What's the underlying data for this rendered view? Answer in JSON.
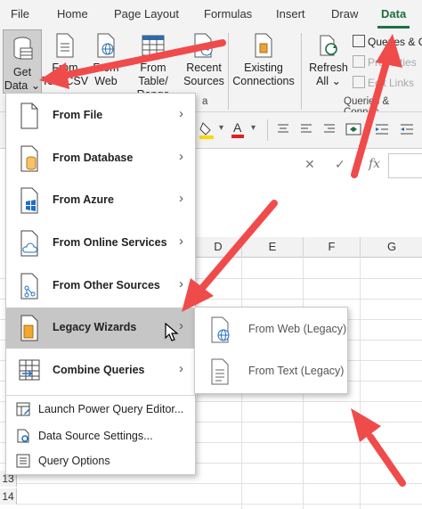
{
  "ribbon_tabs": [
    "File",
    "Home",
    "Page Layout",
    "Formulas",
    "Insert",
    "Draw",
    "Data"
  ],
  "ribbon": {
    "get_data": [
      "Get",
      "Data ⌄"
    ],
    "from_text_csv": [
      "From",
      "Text/CSV"
    ],
    "from_web": [
      "From",
      "Web"
    ],
    "from_table_range": [
      "From Table/",
      "Range"
    ],
    "recent_sources": [
      "Recent",
      "Sources"
    ],
    "existing_connections": [
      "Existing",
      "Connections"
    ],
    "refresh_all": [
      "Refresh",
      "All ⌄"
    ],
    "queries_connections": "Queries & C",
    "properties": "Properties",
    "edit_links": "Edit Links",
    "group_label_get": "a",
    "group_label_queries": "Queries & Connec"
  },
  "formula_bar": {
    "cancel": "✕",
    "confirm": "✓",
    "fx": "fx"
  },
  "columns": [
    "D",
    "E",
    "F",
    "G"
  ],
  "rows": [
    "13",
    "14"
  ],
  "menu": {
    "items": [
      {
        "label": "From File",
        "icon": "file-icon"
      },
      {
        "label": "From Database",
        "icon": "database-icon"
      },
      {
        "label": "From Azure",
        "icon": "azure-icon"
      },
      {
        "label": "From Online Services",
        "icon": "cloud-icon"
      },
      {
        "label": "From Other Sources",
        "icon": "other-sources-icon"
      },
      {
        "label": "Legacy Wizards",
        "icon": "legacy-wizards-icon"
      },
      {
        "label": "Combine Queries",
        "icon": "combine-queries-icon"
      }
    ],
    "simple_items": [
      {
        "label": "Launch Power Query Editor...",
        "icon": "power-query-editor-icon"
      },
      {
        "label": "Data Source Settings...",
        "icon": "data-source-settings-icon"
      },
      {
        "label": "Query Options",
        "icon": "query-options-icon"
      }
    ],
    "chevron": "›"
  },
  "submenu": {
    "items": [
      {
        "label": "From Web (Legacy)",
        "icon": "web-legacy-icon"
      },
      {
        "label": "From Text (Legacy)",
        "icon": "text-legacy-icon"
      }
    ]
  },
  "colors": {
    "accent_green": "#1e7145",
    "arrow_red": "#f04b4b",
    "highlight": "#c6c6c6"
  }
}
